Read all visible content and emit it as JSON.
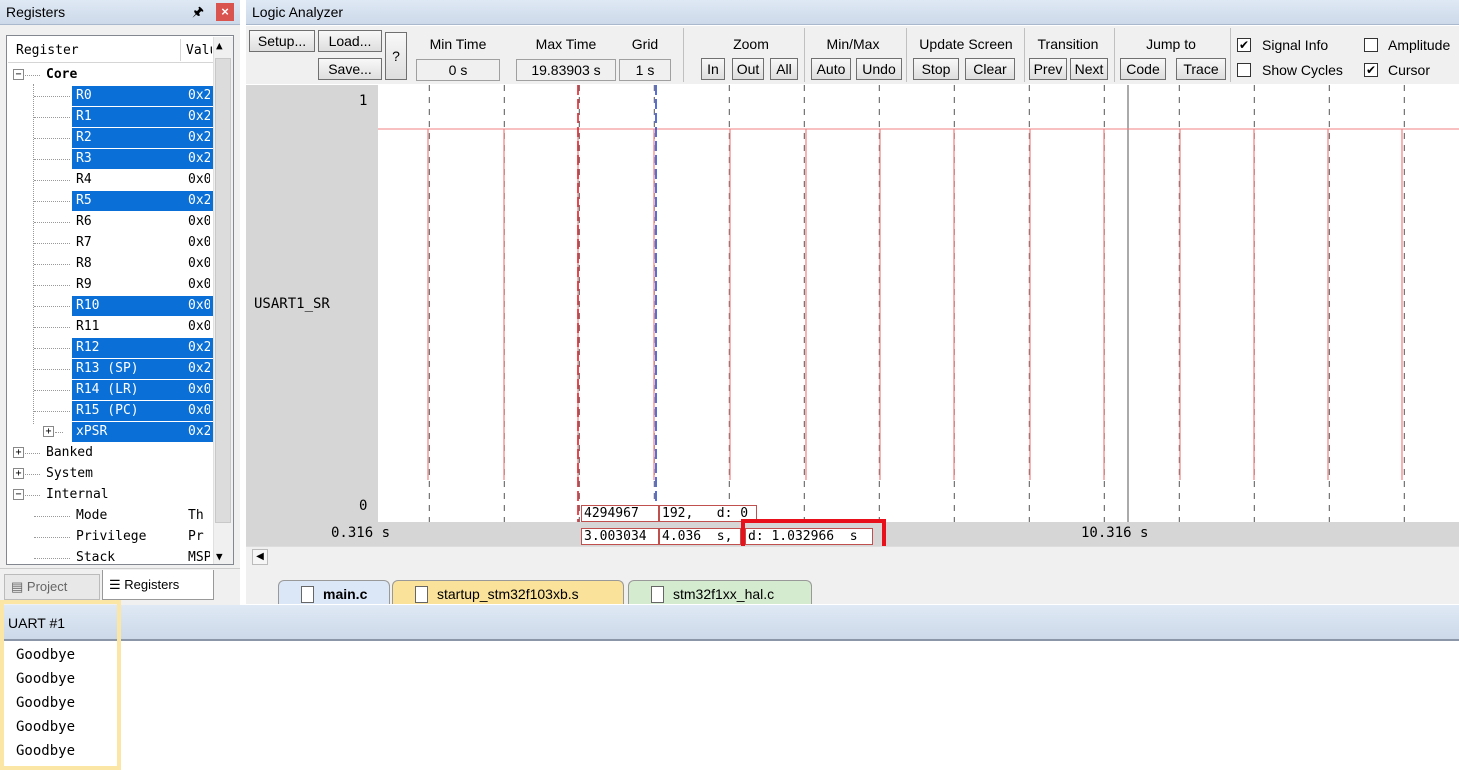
{
  "registers": {
    "title": "Registers",
    "col_register": "Register",
    "col_value": "Value",
    "rows": [
      {
        "name": "Core",
        "value": "",
        "selected": false
      },
      {
        "name": "R0",
        "value": "0x2",
        "selected": true
      },
      {
        "name": "R1",
        "value": "0x2",
        "selected": true
      },
      {
        "name": "R2",
        "value": "0x2",
        "selected": true
      },
      {
        "name": "R3",
        "value": "0x2",
        "selected": true
      },
      {
        "name": "R4",
        "value": "0x0",
        "selected": false
      },
      {
        "name": "R5",
        "value": "0x2",
        "selected": true
      },
      {
        "name": "R6",
        "value": "0x0",
        "selected": false
      },
      {
        "name": "R7",
        "value": "0x0",
        "selected": false
      },
      {
        "name": "R8",
        "value": "0x0",
        "selected": false
      },
      {
        "name": "R9",
        "value": "0x0",
        "selected": false
      },
      {
        "name": "R10",
        "value": "0x0",
        "selected": true
      },
      {
        "name": "R11",
        "value": "0x0",
        "selected": false
      },
      {
        "name": "R12",
        "value": "0x2",
        "selected": true
      },
      {
        "name": "R13 (SP)",
        "value": "0x2",
        "selected": true
      },
      {
        "name": "R14 (LR)",
        "value": "0x0",
        "selected": true
      },
      {
        "name": "R15 (PC)",
        "value": "0x0",
        "selected": true
      },
      {
        "name": "xPSR",
        "value": "0x2",
        "selected": true
      },
      {
        "name": "Banked",
        "value": "",
        "selected": false
      },
      {
        "name": "System",
        "value": "",
        "selected": false
      },
      {
        "name": "Internal",
        "value": "",
        "selected": false
      },
      {
        "name": "Mode",
        "value": "Th",
        "selected": false
      },
      {
        "name": "Privilege",
        "value": "Pr",
        "selected": false
      },
      {
        "name": "Stack",
        "value": "MSP",
        "selected": false
      }
    ],
    "tab_project": "Project",
    "tab_registers": "Registers"
  },
  "logic_analyzer": {
    "title": "Logic Analyzer",
    "setup": "Setup...",
    "load": "Load...",
    "save": "Save...",
    "help": "?",
    "min_time_label": "Min Time",
    "min_time_value": "0 s",
    "max_time_label": "Max Time",
    "max_time_value": "19.83903 s",
    "grid_label": "Grid",
    "grid_value": "1 s",
    "zoom_label": "Zoom",
    "zoom_in": "In",
    "zoom_out": "Out",
    "zoom_all": "All",
    "minmax_label": "Min/Max",
    "auto": "Auto",
    "undo": "Undo",
    "update_label": "Update Screen",
    "stop": "Stop",
    "clear": "Clear",
    "transition_label": "Transition",
    "prev": "Prev",
    "next": "Next",
    "jump_label": "Jump to",
    "code": "Code",
    "trace": "Trace",
    "signal_info": "Signal Info",
    "show_cycles": "Show Cycles",
    "amplitude": "Amplitude",
    "cursor": "Cursor",
    "signal_info_checked": true,
    "show_cycles_checked": false,
    "amplitude_checked": false,
    "cursor_checked": true,
    "signal_name": "USART1_SR",
    "y_high": "1",
    "y_low": "0",
    "axis_left": "0.316 s",
    "axis_right": "10.316 s",
    "info_value_a": "4294967",
    "info_value_b": "192,   d: 0",
    "info_time_a": "3.003034",
    "info_time_b": "4.036  s,",
    "info_delta": "d: 1.032966  s",
    "signal_color": "#f08080",
    "cursor_red": "#e8101a",
    "cursor_blue": "#1f3fd0"
  },
  "editor_tabs": [
    {
      "label": "main.c",
      "active": true
    },
    {
      "label": "startup_stm32f103xb.s",
      "active": false
    },
    {
      "label": "stm32f1xx_hal.c",
      "active": false
    }
  ],
  "uart": {
    "title": "UART #1",
    "lines": [
      "Goodbye",
      "Goodbye",
      "Goodbye",
      "Goodbye",
      "Goodbye"
    ]
  }
}
